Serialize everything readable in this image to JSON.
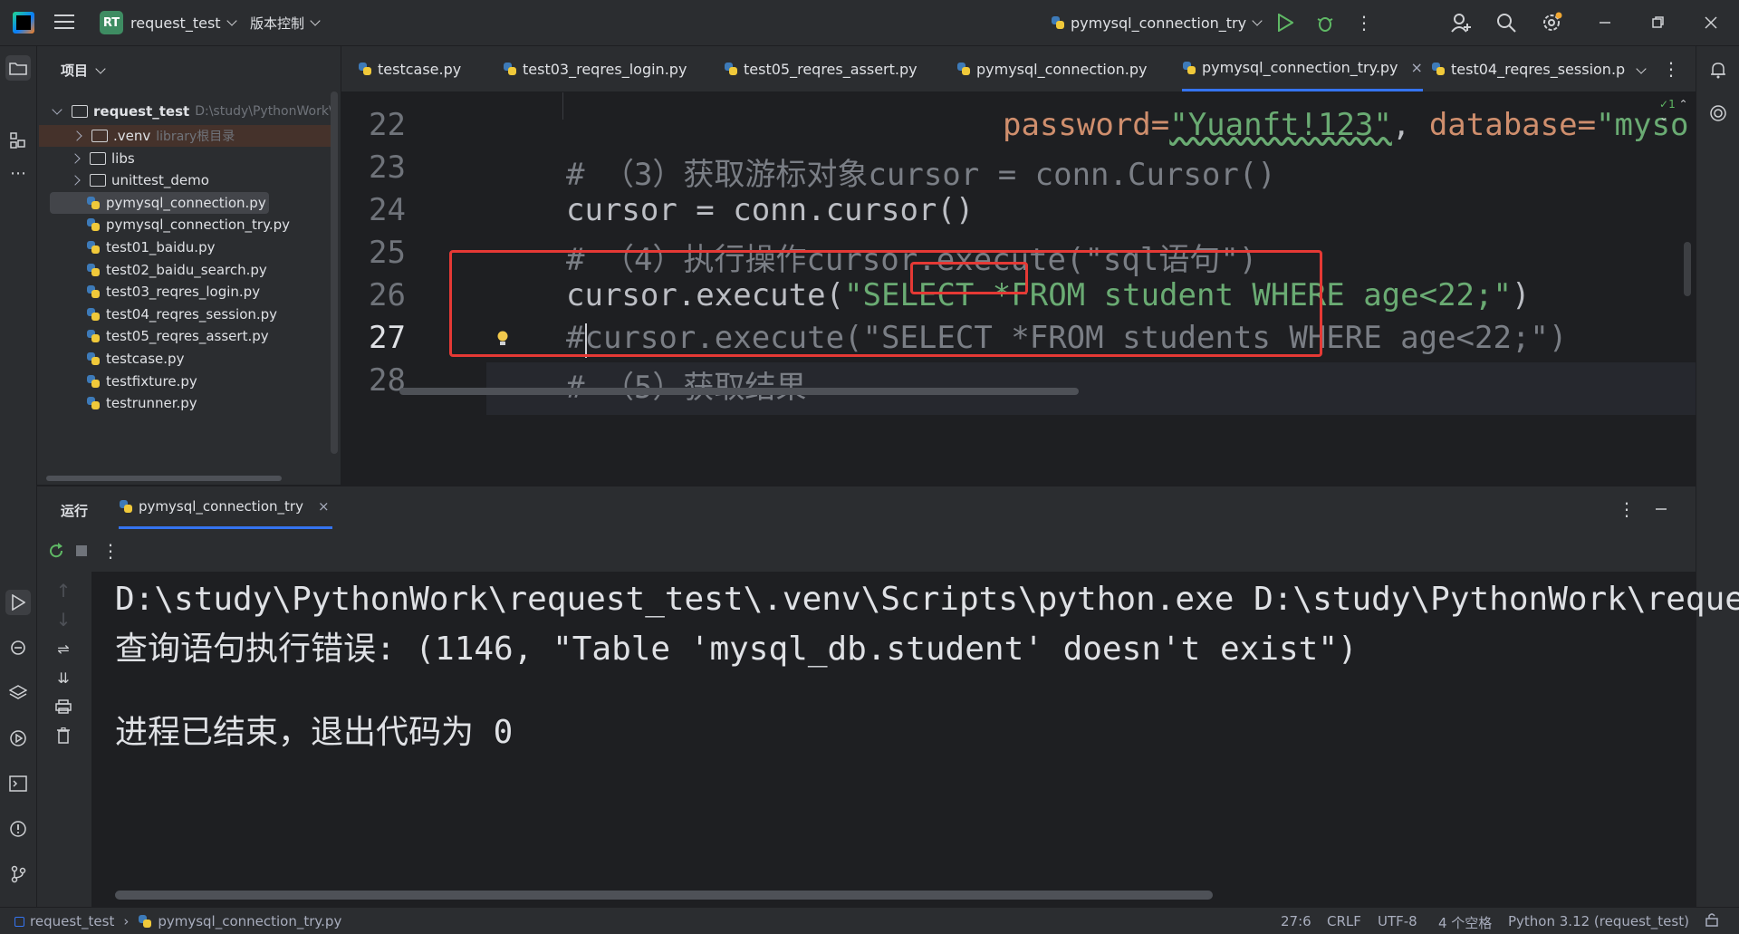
{
  "titlebar": {
    "project_badge": "RT",
    "project_name": "request_test",
    "vcs_menu": "版本控制",
    "run_config": "pymysql_connection_try"
  },
  "project_panel": {
    "title": "项目",
    "root_name": "request_test",
    "root_path": "D:\\study\\PythonWork\\",
    "items": [
      {
        "label": ".venv",
        "hint": "library根目录",
        "type": "folder"
      },
      {
        "label": "libs",
        "hint": "",
        "type": "folder"
      },
      {
        "label": "unittest_demo",
        "hint": "",
        "type": "folder"
      },
      {
        "label": "pymysql_connection.py",
        "hint": "",
        "type": "file"
      },
      {
        "label": "pymysql_connection_try.py",
        "hint": "",
        "type": "file"
      },
      {
        "label": "test01_baidu.py",
        "hint": "",
        "type": "file"
      },
      {
        "label": "test02_baidu_search.py",
        "hint": "",
        "type": "file"
      },
      {
        "label": "test03_reqres_login.py",
        "hint": "",
        "type": "file"
      },
      {
        "label": "test04_reqres_session.py",
        "hint": "",
        "type": "file"
      },
      {
        "label": "test05_reqres_assert.py",
        "hint": "",
        "type": "file"
      },
      {
        "label": "testcase.py",
        "hint": "",
        "type": "file"
      },
      {
        "label": "testfixture.py",
        "hint": "",
        "type": "file"
      },
      {
        "label": "testrunner.py",
        "hint": "",
        "type": "file"
      }
    ]
  },
  "tabs": [
    {
      "label": "testcase.py"
    },
    {
      "label": "test03_reqres_login.py"
    },
    {
      "label": "test05_reqres_assert.py"
    },
    {
      "label": "pymysql_connection.py"
    },
    {
      "label": "pymysql_connection_try.py"
    },
    {
      "label": "test04_reqres_session.p"
    }
  ],
  "editor": {
    "inspection_count": "1",
    "line_numbers": [
      "22",
      "23",
      "24",
      "25",
      "26",
      "27",
      "28"
    ],
    "line22_a": "password=",
    "line22_b": "\"Yuanft!123\"",
    "line22_c": ", ",
    "line22_d": "database=",
    "line22_e": "\"myso",
    "line23": "# （3）获取游标对象cursor = conn.Cursor()",
    "line24": "cursor = conn.cursor()",
    "line25": "# （4）执行操作cursor.execute(\"sql语句\")",
    "line26_a": "cursor.execute(",
    "line26_b": "\"SELECT *FROM student WHERE age<22;\"",
    "line26_c": ")",
    "line27": "#cursor.execute(\"SELECT *FROM students WHERE age<22;\")",
    "line28": "# （5）获取结果"
  },
  "run_panel": {
    "title": "运行",
    "tab": "pymysql_connection_try",
    "console_lines": [
      "D:\\study\\PythonWork\\request_test\\.venv\\Scripts\\python.exe D:\\study\\PythonWork\\reque",
      "查询语句执行错误: (1146, \"Table 'mysql_db.student' doesn't exist\")",
      "",
      "进程已结束，退出代码为 0"
    ]
  },
  "statusbar": {
    "crumb_project": "request_test",
    "crumb_file": "pymysql_connection_try.py",
    "position": "27:6",
    "line_sep": "CRLF",
    "encoding": "UTF-8",
    "indent": "4 个空格",
    "interpreter": "Python 3.12 (request_test)"
  },
  "colors": {
    "highlight_box": "#e53935",
    "accent": "#3574f0"
  }
}
